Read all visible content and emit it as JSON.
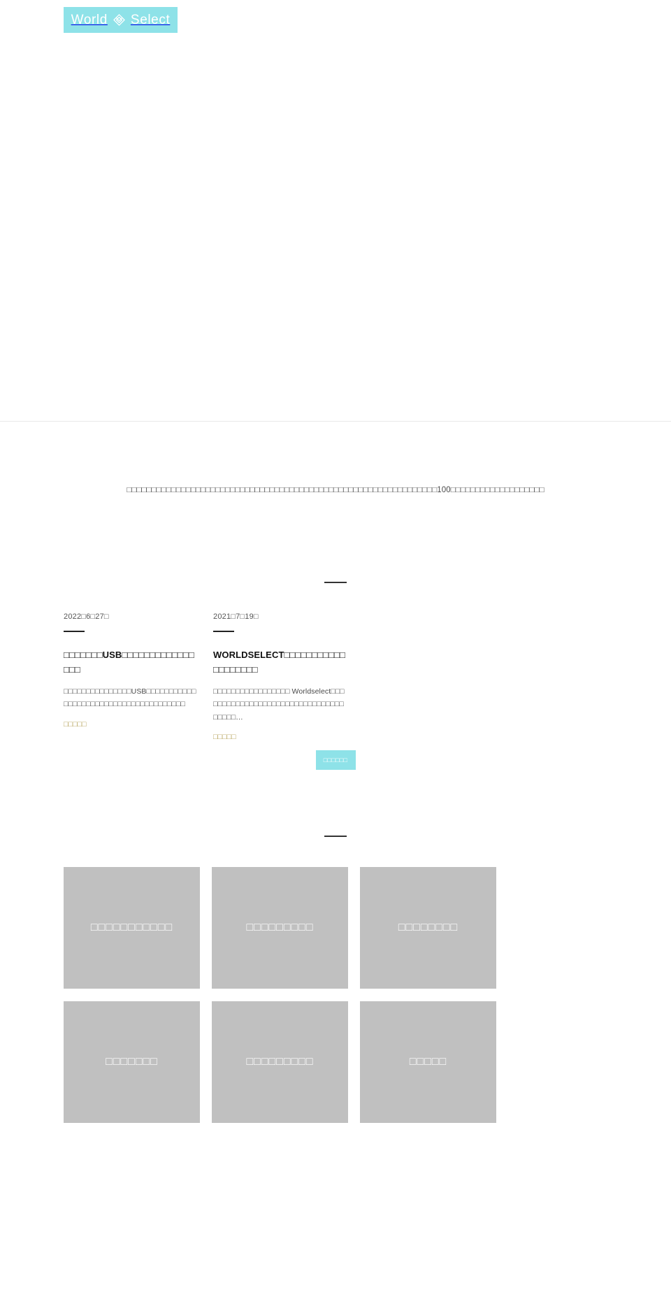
{
  "site": {
    "logo": {
      "word_left": "World",
      "word_right": "Select",
      "mark": "diamond-logo-icon",
      "background_color": "#8ee2e8"
    }
  },
  "intro": {
    "text": "□□□□□□□□□□□□□□□□□□□□□□□□□□□□□□□□□□□□□□□□□□□□□□□□□□□□□□□□□□□□□□□100□□□□□□□□□□□□□□□□□□□"
  },
  "news": {
    "divider": "section-rule",
    "cards": [
      {
        "date": "2022□6□27□",
        "title": "□□□□□□□USB□□□□□□□□□□□□□□□□",
        "excerpt": "□□□□□□□□□□□□□□□USB□□□□□□□□□□□□□□□□□□□□□□□□□□□□□□□□□□□□□□",
        "more_label": "□□□□□"
      },
      {
        "date": "2021□7□19□",
        "title": "WORLDSELECT□□□□□□□□□□□□□□□□□□□",
        "excerpt": "□□□□□□□□□□□□□□□□□ Worldselect□□□□□□□□□□□□□□□□□□□□□□□□□□□□□□□□□□□□□…",
        "more_label": "□□□□□"
      }
    ],
    "list_button_label": "□□□□□□"
  },
  "categories": {
    "divider": "section-rule",
    "tiles": [
      {
        "label": "□□□□□□□□□□□"
      },
      {
        "label": "□□□□□□□□□"
      },
      {
        "label": "□□□□□□□□"
      },
      {
        "label": "□□□□□□□"
      },
      {
        "label": "□□□□□□□□□"
      },
      {
        "label": "□□□□□"
      }
    ]
  }
}
